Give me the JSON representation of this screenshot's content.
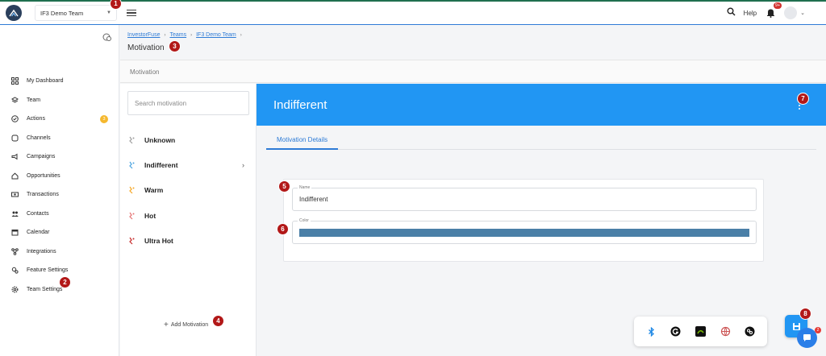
{
  "header": {
    "team_selector": "IF3 Demo Team",
    "help_label": "Help",
    "notifications_badge": "9+"
  },
  "sidebar": {
    "items": [
      {
        "label": "My Dashboard",
        "icon": "dashboard-icon"
      },
      {
        "label": "Team",
        "icon": "layers-icon"
      },
      {
        "label": "Actions",
        "icon": "check-circle-icon",
        "badge": "3"
      },
      {
        "label": "Channels",
        "icon": "channels-icon"
      },
      {
        "label": "Campaigns",
        "icon": "megaphone-icon"
      },
      {
        "label": "Opportunities",
        "icon": "home-icon"
      },
      {
        "label": "Transactions",
        "icon": "money-icon"
      },
      {
        "label": "Contacts",
        "icon": "people-icon"
      },
      {
        "label": "Calendar",
        "icon": "calendar-icon"
      },
      {
        "label": "Integrations",
        "icon": "integrations-icon"
      },
      {
        "label": "Feature Settings",
        "icon": "feature-settings-icon"
      },
      {
        "label": "Team Settings",
        "icon": "gear-icon"
      }
    ]
  },
  "breadcrumb": {
    "items": [
      "InvestorFuse",
      "Teams",
      "IF3 Demo Team"
    ]
  },
  "page": {
    "title": "Motivation",
    "section_title": "Motivation"
  },
  "motivations": {
    "search_placeholder": "Search motivation",
    "items": [
      {
        "label": "Unknown",
        "color": "#9e9e9e"
      },
      {
        "label": "Indifferent",
        "color": "#4aa3df",
        "selected": true
      },
      {
        "label": "Warm",
        "color": "#f5a623"
      },
      {
        "label": "Hot",
        "color": "#e57373"
      },
      {
        "label": "Ultra Hot",
        "color": "#c62828"
      }
    ],
    "add_label": "Add Motivation"
  },
  "detail": {
    "title": "Indifferent",
    "tab_label": "Motivation Details",
    "name_legend": "Name",
    "name_value": "Indifferent",
    "color_legend": "Color",
    "color_value": "#4a7fa7"
  },
  "markers": [
    "1",
    "2",
    "3",
    "4",
    "5",
    "6",
    "7",
    "8"
  ],
  "chat_badge": "2",
  "colors": {
    "accent": "#2196f3",
    "link": "#2e7bd6",
    "marker": "#b21818"
  }
}
